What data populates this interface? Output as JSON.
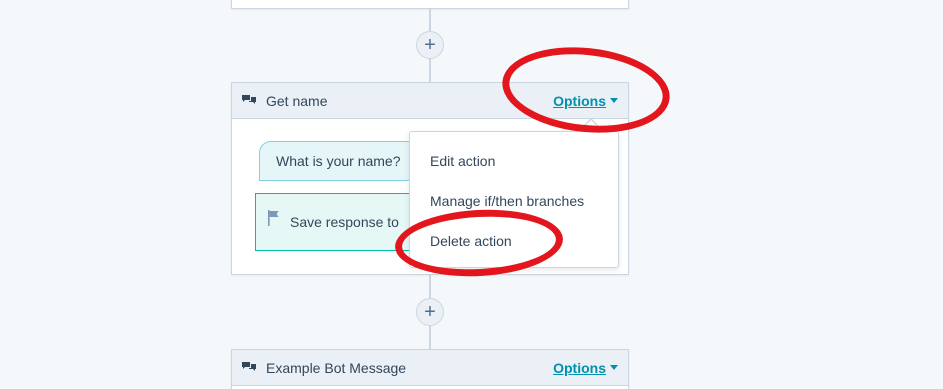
{
  "cards": [
    {
      "title": "Get name",
      "options_label": "Options",
      "message": "What is your name?",
      "save_response": "Save response to"
    },
    {
      "title": "Example Bot Message",
      "options_label": "Options"
    }
  ],
  "add_button_symbol": "+",
  "dropdown": {
    "items": [
      {
        "label": "Edit action"
      },
      {
        "label": "Manage if/then branches"
      },
      {
        "label": "Delete action"
      }
    ]
  },
  "annotation_color": "#e3161d",
  "colors": {
    "link": "#0091ae",
    "header_bg": "#eaf0f6",
    "border": "#cbd6e2"
  }
}
